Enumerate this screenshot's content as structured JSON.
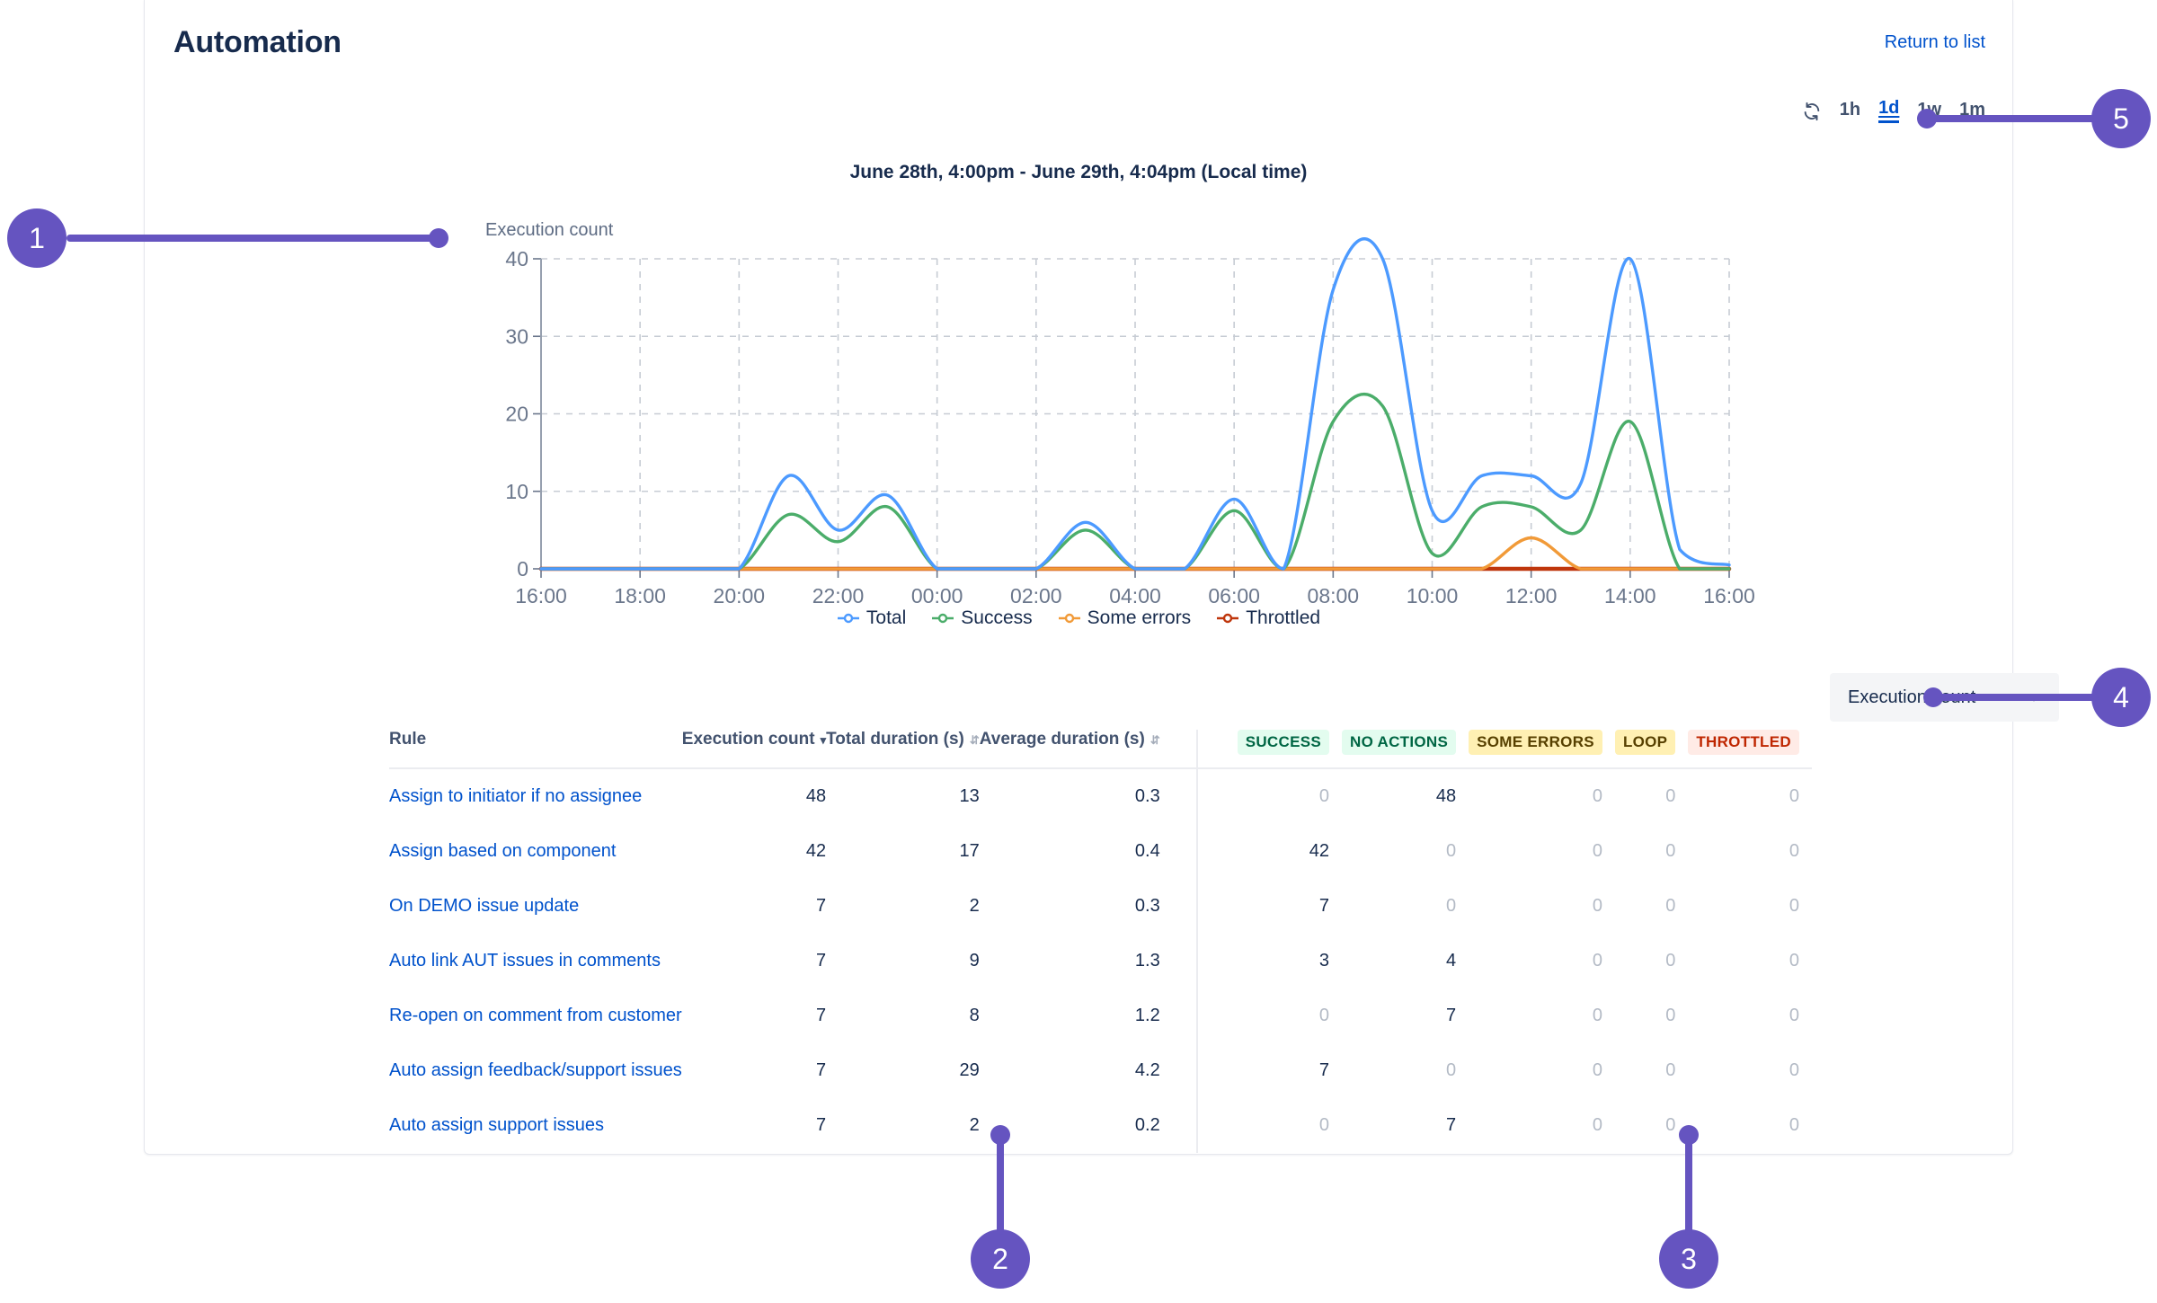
{
  "header": {
    "title": "Automation",
    "return_link": "Return to list"
  },
  "range_controls": {
    "refresh_icon": "refresh-icon",
    "options": [
      {
        "label": "1h",
        "active": false
      },
      {
        "label": "1d",
        "active": true
      },
      {
        "label": "1w",
        "active": false
      },
      {
        "label": "1m",
        "active": false
      }
    ]
  },
  "chart_data": {
    "type": "line",
    "title": "June 28th, 4:00pm - June 29th, 4:04pm (Local time)",
    "ylabel": "Execution count",
    "xlabel": "",
    "ylim": [
      0,
      40
    ],
    "yticks": [
      0,
      10,
      20,
      30,
      40
    ],
    "xticks": [
      "16:00",
      "18:00",
      "20:00",
      "22:00",
      "00:00",
      "02:00",
      "04:00",
      "06:00",
      "08:00",
      "10:00",
      "12:00",
      "14:00",
      "16:00"
    ],
    "grid": true,
    "legend_position": "bottom",
    "x_hours": [
      16,
      17,
      18,
      19,
      20,
      21,
      22,
      23,
      0,
      1,
      2,
      3,
      4,
      5,
      6,
      7,
      8,
      9,
      10,
      11,
      12,
      13,
      14,
      15,
      16
    ],
    "series": [
      {
        "name": "Total",
        "color": "#4c9aff",
        "values": [
          0,
          0,
          0,
          0,
          0,
          12,
          5,
          9.5,
          0,
          0,
          0,
          6,
          0,
          0,
          9,
          0,
          36,
          40,
          7.5,
          12,
          12,
          11,
          40,
          2.5,
          0.5
        ]
      },
      {
        "name": "Success",
        "color": "#4bad6a",
        "values": [
          0,
          0,
          0,
          0,
          0,
          7,
          3.5,
          8,
          0,
          0,
          0,
          5,
          0,
          0,
          7.5,
          0,
          19,
          21,
          2,
          8,
          8,
          5,
          19,
          0,
          0
        ]
      },
      {
        "name": "Some errors",
        "color": "#f19a38",
        "values": [
          0,
          0,
          0,
          0,
          0,
          0,
          0,
          0,
          0,
          0,
          0,
          0,
          0,
          0,
          0,
          0,
          0,
          0,
          0,
          0,
          4,
          0,
          0,
          0,
          0
        ]
      },
      {
        "name": "Throttled",
        "color": "#bf360c",
        "values": [
          0,
          0,
          0,
          0,
          0,
          0,
          0,
          0,
          0,
          0,
          0,
          0,
          0,
          0,
          0,
          0,
          0,
          0,
          0,
          0,
          0,
          0,
          0,
          0,
          0
        ]
      }
    ]
  },
  "metric_select": {
    "value": "Execution count",
    "chevron_icon": "chevron-down-icon"
  },
  "table": {
    "columns": [
      {
        "key": "rule",
        "label": "Rule",
        "sortable": false,
        "type": "text"
      },
      {
        "key": "exec",
        "label": "Execution count",
        "sortable": true,
        "sorted": "desc",
        "type": "num"
      },
      {
        "key": "total",
        "label": "Total duration (s)",
        "sortable": true,
        "type": "num"
      },
      {
        "key": "avg",
        "label": "Average duration (s)",
        "sortable": true,
        "type": "num"
      },
      {
        "key": "success",
        "label": "SUCCESS",
        "chip": "chip-success",
        "type": "chip"
      },
      {
        "key": "noact",
        "label": "NO ACTIONS",
        "chip": "chip-noaction",
        "type": "chip"
      },
      {
        "key": "someerr",
        "label": "SOME ERRORS",
        "chip": "chip-someerr",
        "type": "chip"
      },
      {
        "key": "loop",
        "label": "LOOP",
        "chip": "chip-loop",
        "type": "chip"
      },
      {
        "key": "throt",
        "label": "THROTTLED",
        "chip": "chip-throttled",
        "type": "chip"
      }
    ],
    "rows": [
      {
        "rule": "Assign to initiator if no assignee",
        "exec": "48",
        "total": "13",
        "avg": "0.3",
        "success": "0",
        "noact": "48",
        "someerr": "0",
        "loop": "0",
        "throt": "0"
      },
      {
        "rule": "Assign based on component",
        "exec": "42",
        "total": "17",
        "avg": "0.4",
        "success": "42",
        "noact": "0",
        "someerr": "0",
        "loop": "0",
        "throt": "0"
      },
      {
        "rule": "On DEMO issue update",
        "exec": "7",
        "total": "2",
        "avg": "0.3",
        "success": "7",
        "noact": "0",
        "someerr": "0",
        "loop": "0",
        "throt": "0"
      },
      {
        "rule": "Auto link AUT issues in comments",
        "exec": "7",
        "total": "9",
        "avg": "1.3",
        "success": "3",
        "noact": "4",
        "someerr": "0",
        "loop": "0",
        "throt": "0"
      },
      {
        "rule": "Re-open on comment from customer",
        "exec": "7",
        "total": "8",
        "avg": "1.2",
        "success": "0",
        "noact": "7",
        "someerr": "0",
        "loop": "0",
        "throt": "0"
      },
      {
        "rule": "Auto assign feedback/support issues",
        "exec": "7",
        "total": "29",
        "avg": "4.2",
        "success": "7",
        "noact": "0",
        "someerr": "0",
        "loop": "0",
        "throt": "0"
      },
      {
        "rule": "Auto assign support issues",
        "exec": "7",
        "total": "2",
        "avg": "0.2",
        "success": "0",
        "noact": "7",
        "someerr": "0",
        "loop": "0",
        "throt": "0"
      }
    ]
  },
  "callouts": [
    {
      "num": "1"
    },
    {
      "num": "2"
    },
    {
      "num": "3"
    },
    {
      "num": "4"
    },
    {
      "num": "5"
    }
  ],
  "colors": {
    "accent_callout": "#6554c0",
    "link": "#0052cc",
    "text": "#172b4d",
    "subtle": "#5e6c84"
  }
}
